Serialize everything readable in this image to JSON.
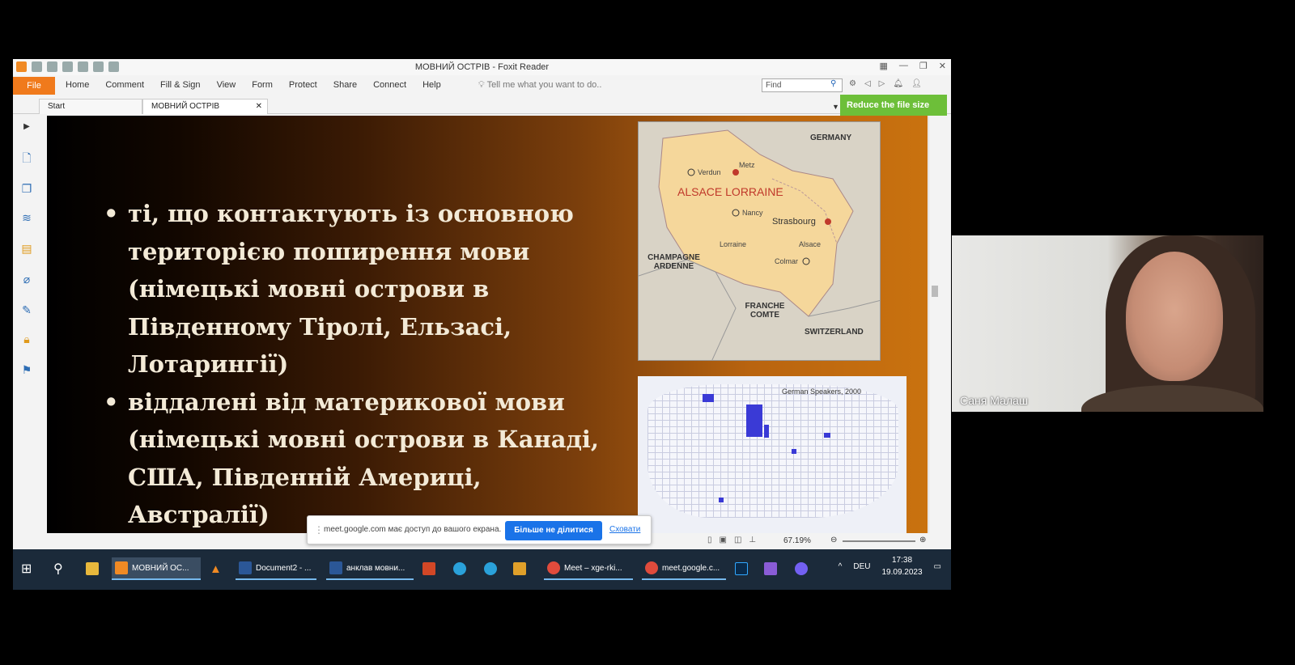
{
  "window": {
    "title": "МОВНИЙ ОСТРІВ - Foxit Reader",
    "menu": [
      "Home",
      "Comment",
      "Fill & Sign",
      "View",
      "Form",
      "Protect",
      "Share",
      "Connect",
      "Help"
    ],
    "file_label": "File",
    "tell_me": "Tell me what you want to do..",
    "find_placeholder": "Find"
  },
  "tabs": [
    {
      "label": "Start"
    },
    {
      "label": "МОВНИЙ ОСТРІВ",
      "active": true
    }
  ],
  "reduce_button": "Reduce the file size",
  "slide": {
    "bullets": [
      "ті, що контактують із основною територією поширення мови (німецькі мовні острови в Південному Тіролі, Ельзасі, Лотарингії)",
      "віддалені від материкової мови (німецькі мовні острови в Канаді, США, Південній Америці, Австралії)"
    ],
    "map1": {
      "labels": {
        "germany": "GERMANY",
        "metz": "Metz",
        "verdun": "Verdun",
        "region": "ALSACE LORRAINE",
        "nancy": "Nancy",
        "strasbourg": "Strasbourg",
        "lorraine": "Lorraine",
        "alsace": "Alsace",
        "champagne": "CHAMPAGNE ARDENNE",
        "colmar": "Colmar",
        "franche": "FRANCHE COMTE",
        "switzerland": "SWITZERLAND"
      }
    },
    "map2": {
      "title": "German Speakers, 2000"
    }
  },
  "status": {
    "zoom": "67.19%"
  },
  "share_bar": {
    "message": "meet.google.com має доступ до вашого екрана.",
    "stop_label": "Більше не ділитися",
    "hide_label": "Сховати"
  },
  "taskbar": {
    "items": [
      "МОВНИЙ ОС...",
      "Document2 - ...",
      "анклав мовни...",
      "Meet – xge-rki...",
      "meet.google.c..."
    ],
    "lang": "DEU",
    "time": "17:38",
    "date": "19.09.2023"
  },
  "participant": {
    "name": "Саня Малаш"
  }
}
